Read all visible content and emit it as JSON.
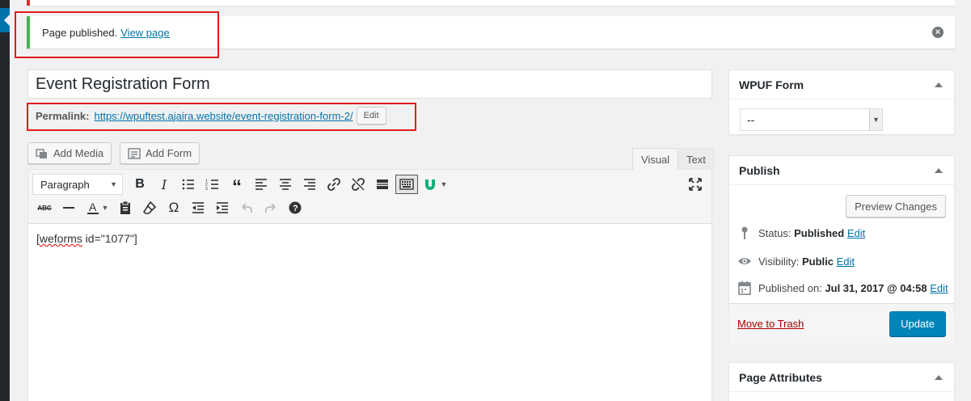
{
  "notice": {
    "message": "Page published.",
    "link_label": "View page",
    "dismiss_icon": "close-icon",
    "accent_color": "#46b450"
  },
  "post": {
    "title": "Event Registration Form",
    "permalink_label": "Permalink:",
    "permalink_url": "https://wpuftest.ajaira.website/event-registration-form-2/",
    "permalink_edit_label": "Edit"
  },
  "media_buttons": {
    "add_media": "Add Media",
    "add_form": "Add Form"
  },
  "editor": {
    "tabs": [
      "Visual",
      "Text"
    ],
    "active_tab": "Visual",
    "format_select": "Paragraph",
    "content_prefix": "[",
    "content_misspelled": "weforms",
    "content_suffix": " id=\"1077\"]"
  },
  "wpuf_box": {
    "title": "WPUF Form",
    "select_value": "--"
  },
  "publish_box": {
    "title": "Publish",
    "preview_label": "Preview Changes",
    "status_label": "Status:",
    "status_value": "Published",
    "visibility_label": "Visibility:",
    "visibility_value": "Public",
    "published_label": "Published on:",
    "published_value": "Jul 31, 2017 @ 04:58",
    "edit_label": "Edit",
    "trash_label": "Move to Trash",
    "update_label": "Update",
    "primary_color": "#0085ba"
  },
  "page_attributes_box": {
    "title": "Page Attributes"
  }
}
